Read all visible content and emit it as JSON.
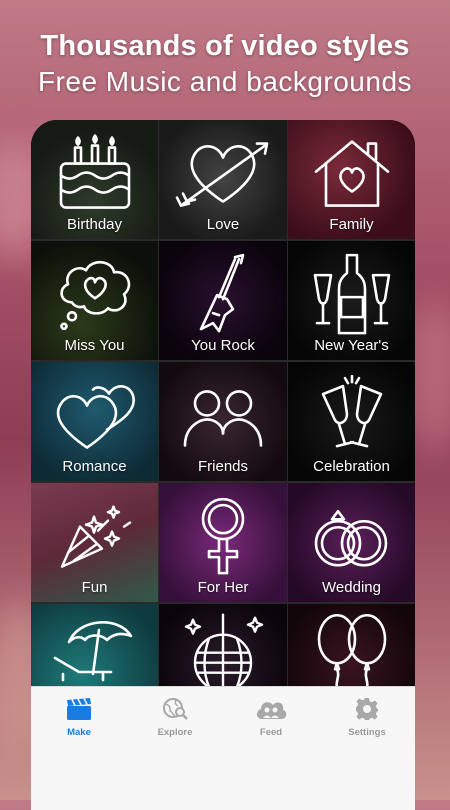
{
  "headline": {
    "line1": "Thousands of video styles",
    "line2": "Free Music and backgrounds"
  },
  "tiles": [
    {
      "label": "Birthday",
      "icon": "cake-icon"
    },
    {
      "label": "Love",
      "icon": "heart-arrow-icon"
    },
    {
      "label": "Family",
      "icon": "house-heart-icon"
    },
    {
      "label": "Miss You",
      "icon": "thought-heart-icon"
    },
    {
      "label": "You Rock",
      "icon": "guitar-icon"
    },
    {
      "label": "New Year's",
      "icon": "champagne-icon"
    },
    {
      "label": "Romance",
      "icon": "two-hearts-icon"
    },
    {
      "label": "Friends",
      "icon": "friends-icon"
    },
    {
      "label": "Celebration",
      "icon": "toast-glasses-icon"
    },
    {
      "label": "Fun",
      "icon": "party-popper-icon"
    },
    {
      "label": "For Her",
      "icon": "female-symbol-icon"
    },
    {
      "label": "Wedding",
      "icon": "rings-icon"
    },
    {
      "label": "",
      "icon": "beach-umbrella-icon"
    },
    {
      "label": "",
      "icon": "disco-ball-icon"
    },
    {
      "label": "",
      "icon": "balloons-icon"
    }
  ],
  "tabbar": {
    "tabs": [
      {
        "label": "Make",
        "icon": "clapperboard-icon",
        "active": true
      },
      {
        "label": "Explore",
        "icon": "globe-search-icon",
        "active": false
      },
      {
        "label": "Feed",
        "icon": "cloud-people-icon",
        "active": false
      },
      {
        "label": "Settings",
        "icon": "gear-icon",
        "active": false
      }
    ],
    "active_color": "#1a7ce0",
    "inactive_color": "#9a9a9a"
  }
}
